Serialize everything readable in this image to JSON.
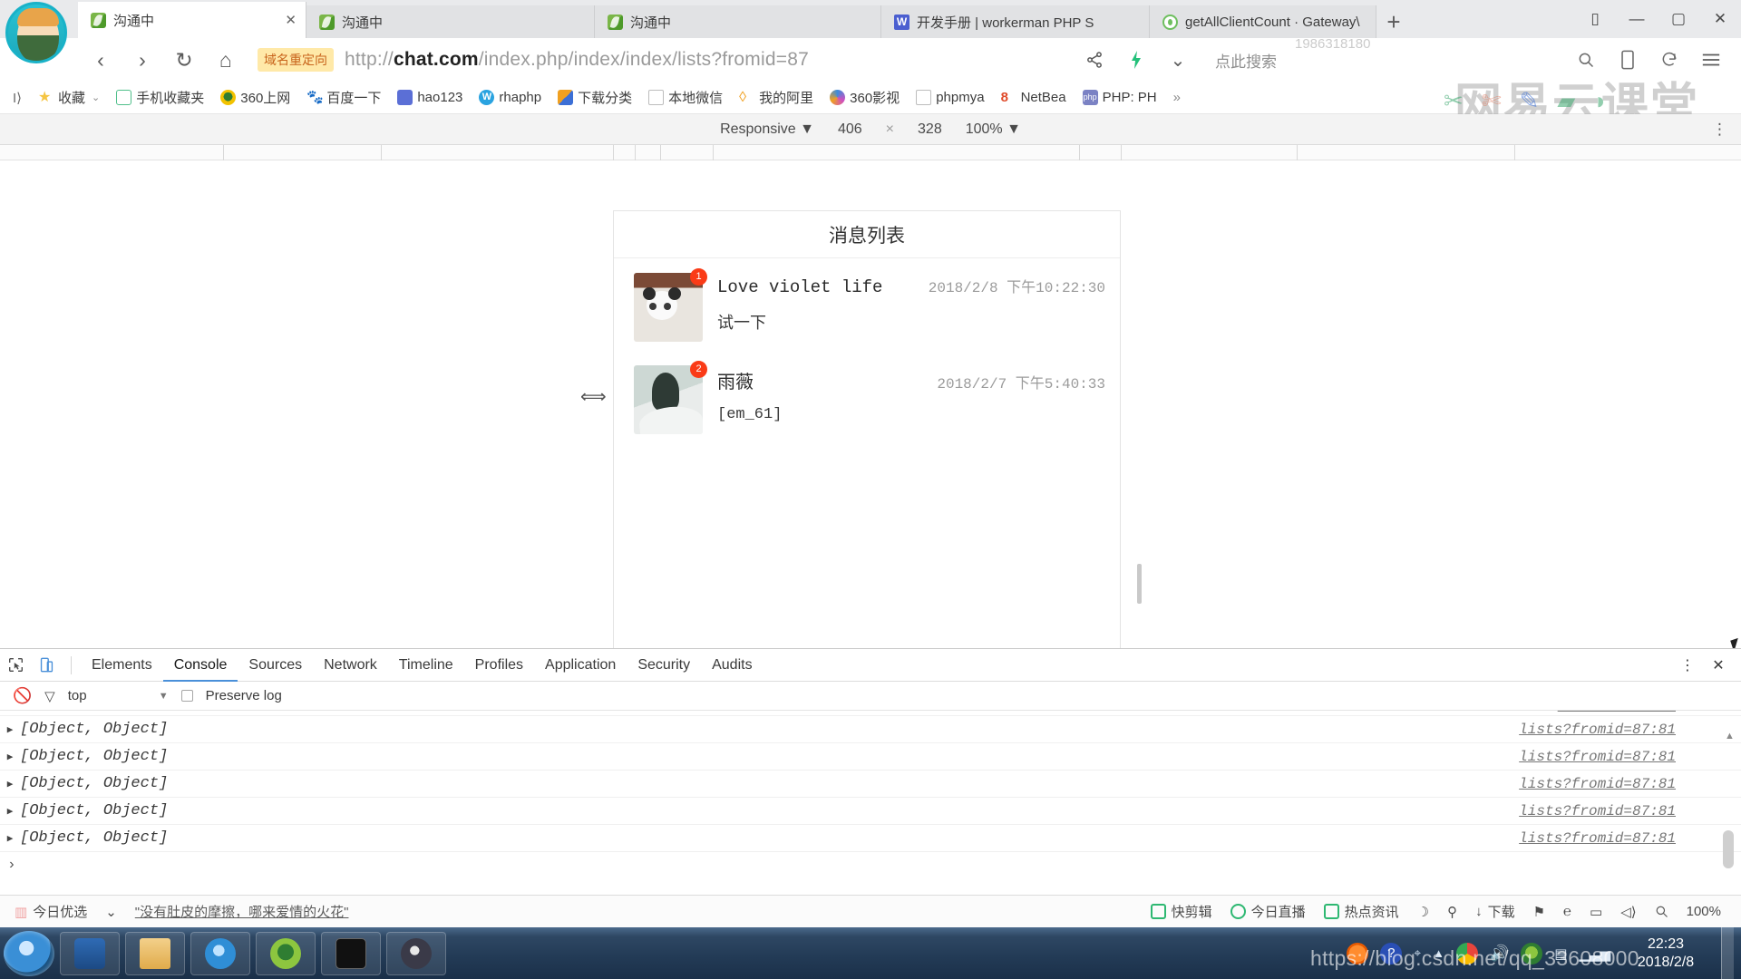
{
  "browser": {
    "tabs": [
      {
        "title": "沟通中",
        "icon": "leaf-icon",
        "active": true,
        "closable": true
      },
      {
        "title": "沟通中",
        "icon": "leaf-icon",
        "active": false,
        "closable": false
      },
      {
        "title": "沟通中",
        "icon": "leaf-icon",
        "active": false,
        "closable": false
      },
      {
        "title": "开发手册 | workerman PHP S",
        "icon": "book-icon",
        "active": false,
        "closable": false
      },
      {
        "title": "getAllClientCount · Gateway\\",
        "icon": "gateway-icon",
        "active": false,
        "closable": false
      }
    ],
    "new_tab_label": "+",
    "window_controls": {
      "collections": "▯",
      "minimize": "—",
      "maximize": "▢",
      "close": "✕"
    },
    "nav": {
      "back": "‹",
      "forward": "›",
      "reload": "↻",
      "home": "⌂",
      "redirect_badge": "域名重定向",
      "url_prefix": "http://",
      "url_domain": "chat.com",
      "url_path": "/index.php/index/index/lists?fromid=87",
      "share": "share-icon",
      "boost": "lightning-icon",
      "more_caret": "⌄",
      "search_hint": "点此搜索",
      "right_icons": [
        "search-icon",
        "mobile-icon",
        "history-icon",
        "menu-icon"
      ]
    },
    "bookmarks": [
      {
        "label": "",
        "icon": "expand-icon"
      },
      {
        "label": "收藏",
        "icon": "star-icon",
        "caret": "⌄"
      },
      {
        "label": "手机收藏夹",
        "icon": "phone-icon"
      },
      {
        "label": "360上网",
        "icon": "360-icon"
      },
      {
        "label": "百度一下",
        "icon": "baidu-icon"
      },
      {
        "label": "hao123",
        "icon": "hao123-icon"
      },
      {
        "label": "rhaphp",
        "icon": "w-icon"
      },
      {
        "label": "下载分类",
        "icon": "download-icon"
      },
      {
        "label": "本地微信",
        "icon": "page-icon"
      },
      {
        "label": "我的阿里",
        "icon": "alibaba-icon"
      },
      {
        "label": "360影视",
        "icon": "360video-icon"
      },
      {
        "label": "phpmya",
        "icon": "page-icon"
      },
      {
        "label": "NetBea",
        "icon": "netbeans-icon"
      },
      {
        "label": "PHP: PH",
        "icon": "php-icon"
      },
      {
        "label": "»",
        "icon": "overflow-icon"
      }
    ],
    "watermark_netease": "网易云课堂",
    "watermark_number": "1986318180"
  },
  "device_toolbar": {
    "device": "Responsive",
    "device_caret": "▼",
    "width": "406",
    "times": "×",
    "height": "328",
    "zoom": "100%",
    "zoom_caret": "▼",
    "menu": "⋮"
  },
  "page": {
    "title": "消息列表",
    "messages": [
      {
        "avatar": "panda-avatar",
        "badge": "1",
        "name": "Love violet life",
        "name_is_cn": false,
        "time": "2018/2/8 下午10:22:30",
        "preview": "试一下",
        "preview_mono": false
      },
      {
        "avatar": "photo-avatar",
        "badge": "2",
        "name": "雨薇",
        "name_is_cn": true,
        "time": "2018/2/7 下午5:40:33",
        "preview": "[em_61]",
        "preview_mono": true
      }
    ]
  },
  "devtools": {
    "inspect_icon": "inspect-icon",
    "device_icon": "device-toggle-icon",
    "tabs": [
      "Elements",
      "Console",
      "Sources",
      "Network",
      "Timeline",
      "Profiles",
      "Application",
      "Security",
      "Audits"
    ],
    "active_tab": "Console",
    "more_icon": "⋮",
    "close_icon": "✕",
    "filter": {
      "clear_icon": "clear-console-icon",
      "filter_icon": "funnel-icon",
      "context": "top",
      "context_caret": "▼",
      "preserve_log_label": "Preserve log",
      "preserve_log_checked": false
    },
    "console_lines": [
      {
        "expander": "▶",
        "text": "[Object, Object]",
        "source": "lists?fromid=87:81"
      },
      {
        "expander": "▶",
        "text": "[Object, Object]",
        "source": "lists?fromid=87:81"
      },
      {
        "expander": "▶",
        "text": "[Object, Object]",
        "source": "lists?fromid=87:81"
      },
      {
        "expander": "▶",
        "text": "[Object, Object]",
        "source": "lists?fromid=87:81"
      },
      {
        "expander": "▶",
        "text": "[Object, Object]",
        "source": "lists?fromid=87:81"
      }
    ],
    "prompt": "›"
  },
  "bottom_bar": {
    "today_label": "今日优选",
    "caret": "⌄",
    "quote": "\"没有肚皮的摩擦，哪来爱情的火花\"",
    "right_items": [
      {
        "label": "快剪辑",
        "icon": "clip-icon"
      },
      {
        "label": "今日直播",
        "icon": "live-icon"
      },
      {
        "label": "热点资讯",
        "icon": "news-icon"
      },
      {
        "label": "",
        "icon": "moon-icon"
      },
      {
        "label": "",
        "icon": "mute-ads-icon"
      },
      {
        "label": "下载",
        "icon": "download-arrow-icon"
      },
      {
        "label": "",
        "icon": "flag-icon"
      },
      {
        "label": "",
        "icon": "edge-icon"
      },
      {
        "label": "",
        "icon": "window-icon"
      },
      {
        "label": "",
        "icon": "sound-icon"
      },
      {
        "label": "",
        "icon": "zoom-search-icon"
      },
      {
        "label": "100%",
        "icon": ""
      }
    ]
  },
  "taskbar": {
    "start": "start-orb-icon",
    "buttons": [
      "calc-icon",
      "folder-icon",
      "ie-icon",
      "360browser-icon",
      "cmd-icon",
      "obs-icon"
    ],
    "tray": [
      "sogou-icon",
      "help-icon",
      "net-icon",
      "arrow-up-icon",
      "chrome-icon",
      "volume-icon",
      "360safe-icon",
      "screen-icon",
      "signal-icon"
    ],
    "time": "22:23",
    "date": "2018/2/8",
    "watermark": "https://blog.csdn.net/qq_33608000"
  }
}
